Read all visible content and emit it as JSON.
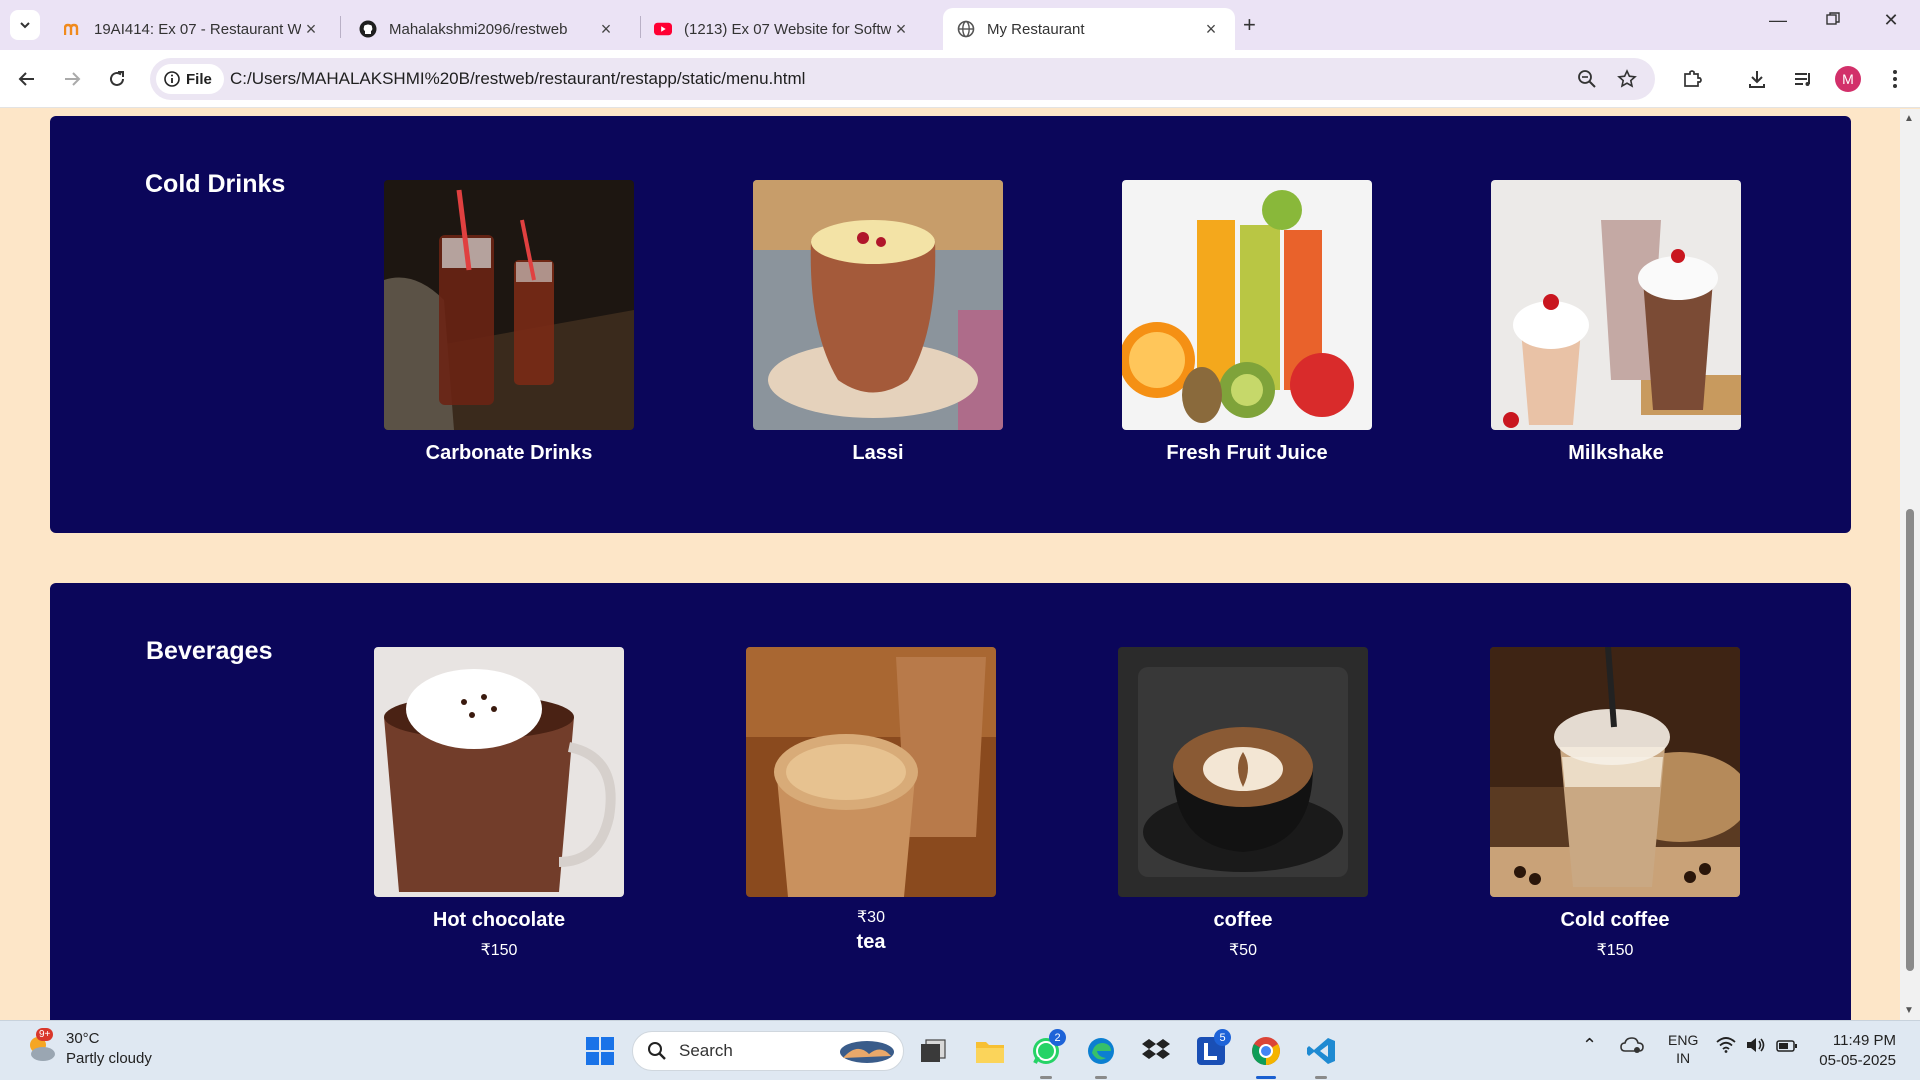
{
  "browser": {
    "tabs": [
      {
        "title": "19AI414: Ex 07 - Restaurant Website",
        "icon": "moodle-icon"
      },
      {
        "title": "Mahalakshmi2096/restweb",
        "icon": "github-icon"
      },
      {
        "title": "(1213) Ex 07 Website for Software Company",
        "icon": "youtube-icon"
      },
      {
        "title": "My Restaurant",
        "icon": "globe-icon",
        "active": true
      }
    ],
    "omnibox": {
      "chip_label": "File",
      "url": "C:/Users/MAHALAKSHMI%20B/restweb/restaurant/restapp/static/menu.html"
    },
    "profile_initial": "M"
  },
  "page": {
    "sections": [
      {
        "title": "Cold Drinks",
        "items": [
          {
            "name": "Carbonate Drinks"
          },
          {
            "name": "Lassi"
          },
          {
            "name": "Fresh Fruit Juice"
          },
          {
            "name": "Milkshake"
          }
        ]
      },
      {
        "title": "Beverages",
        "items": [
          {
            "name": "Hot chocolate",
            "price": "₹150"
          },
          {
            "name": "tea",
            "price": "₹30"
          },
          {
            "name": "coffee",
            "price": "₹50"
          },
          {
            "name": "Cold coffee",
            "price": "₹150"
          }
        ]
      }
    ]
  },
  "taskbar": {
    "weather": {
      "temp": "30°C",
      "condition": "Partly cloudy",
      "badge": "9+"
    },
    "search_placeholder": "Search",
    "whatsapp_badge": "2",
    "lens_badge": "5",
    "lang_1": "ENG",
    "lang_2": "IN",
    "time": "11:49 PM",
    "date": "05-05-2025"
  },
  "colors": {
    "page_background": "#fde6c8",
    "section_background": "#0b065a",
    "tabstrip": "#ebe3f5",
    "accent": "#1a5fd0"
  }
}
